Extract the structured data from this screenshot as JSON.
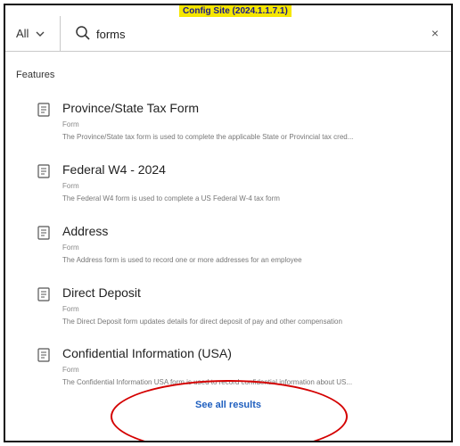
{
  "env_badge": "Config Site (2024.1.1.7.1)",
  "search": {
    "scope_label": "All",
    "query": "forms",
    "clear_label": "×"
  },
  "section_title": "Features",
  "items": [
    {
      "title": "Province/State Tax Form",
      "type": "Form",
      "description": "The Province/State tax form is used to complete the applicable State or Provincial tax cred..."
    },
    {
      "title": "Federal W4 - 2024",
      "type": "Form",
      "description": "The Federal W4 form is used to complete a US Federal W-4 tax form"
    },
    {
      "title": "Address",
      "type": "Form",
      "description": "The Address form is used to record one or more addresses for an employee"
    },
    {
      "title": "Direct Deposit",
      "type": "Form",
      "description": "The Direct Deposit form updates details for direct deposit of pay and other compensation"
    },
    {
      "title": "Confidential Information (USA)",
      "type": "Form",
      "description": "The Confidential Information USA form is used to record confidential information about US..."
    }
  ],
  "see_all_label": "See all results",
  "colors": {
    "link": "#1f5fbf",
    "annotation": "#d40000",
    "badge_bg": "#f5e600"
  },
  "icons": {
    "scope": "chevron-down-icon",
    "search": "search-icon",
    "item": "document-icon"
  }
}
